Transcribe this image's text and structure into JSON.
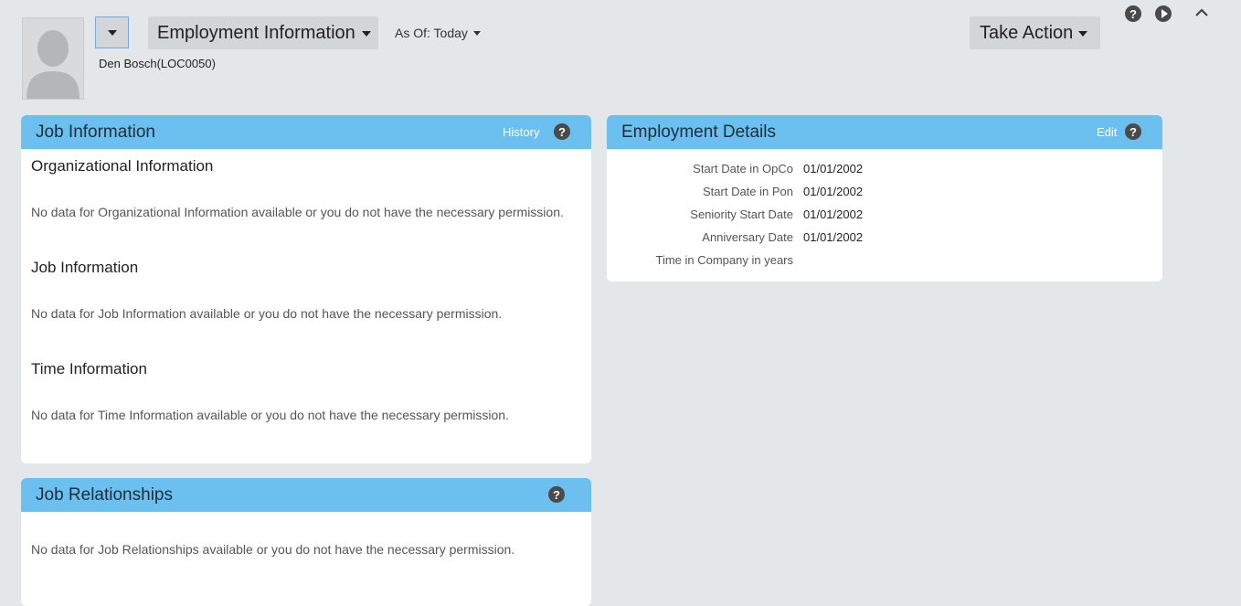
{
  "header": {
    "view_title": "Employment Information",
    "as_of": "As Of: Today",
    "employee_name": "Den Bosch(LOC0050)",
    "take_action": "Take Action",
    "help_icon": "?",
    "icons": [
      "help-icon",
      "play-icon",
      "collapse-chevron-icon",
      "chevron-down-icon",
      "avatar-placeholder-icon"
    ]
  },
  "job_info": {
    "title": "Job Information",
    "history_link": "History",
    "sections": [
      {
        "title": "Organizational Information",
        "message": "No data for Organizational Information available or you do not have the necessary permission."
      },
      {
        "title": "Job Information",
        "message": "No data for Job Information available or you do not have the necessary permission."
      },
      {
        "title": "Time Information",
        "message": "No data for Time Information available or you do not have the necessary permission."
      }
    ]
  },
  "job_relationships": {
    "title": "Job Relationships",
    "message": "No data for Job Relationships available or you do not have the necessary permission."
  },
  "employment_details": {
    "title": "Employment Details",
    "edit_link": "Edit",
    "rows": [
      {
        "label": "Start Date in OpCo",
        "value": "01/01/2002"
      },
      {
        "label": "Start Date in Pon",
        "value": "01/01/2002"
      },
      {
        "label": "Seniority Start Date",
        "value": "01/01/2002"
      },
      {
        "label": "Anniversary Date",
        "value": "01/01/2002"
      },
      {
        "label": "Time in Company in years",
        "value": ""
      }
    ]
  },
  "colors": {
    "background": "#e4e7ea",
    "card_header": "#6cc0ef",
    "button_gray": "#d3d6d9",
    "icon_dark": "#4a4a4a"
  }
}
